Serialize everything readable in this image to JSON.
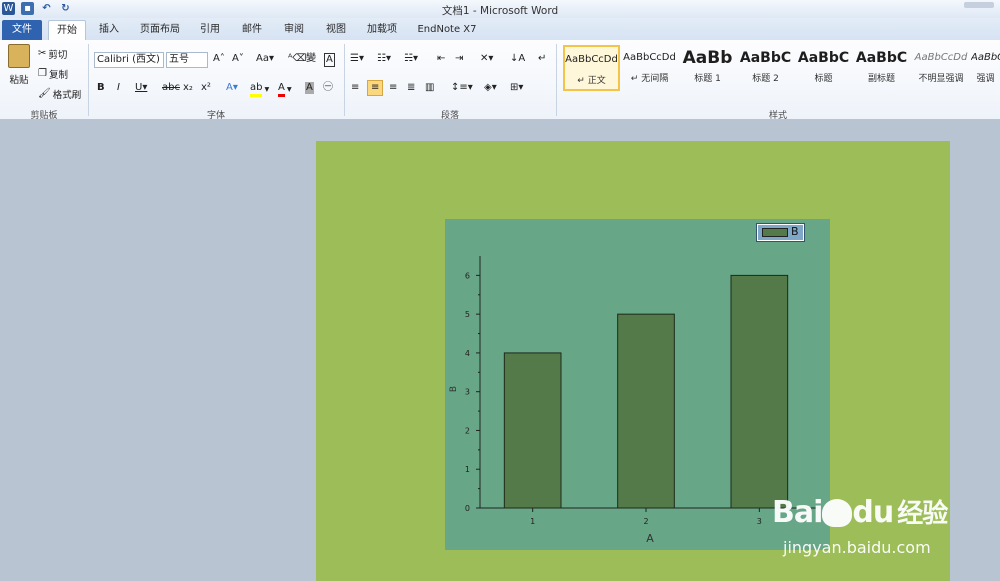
{
  "window": {
    "title": "文档1 - Microsoft Word"
  },
  "tabs": [
    "文件",
    "开始",
    "插入",
    "页面布局",
    "引用",
    "邮件",
    "审阅",
    "视图",
    "加载项",
    "EndNote X7"
  ],
  "clipboard": {
    "paste": "粘贴",
    "cut": "剪切",
    "copy": "复制",
    "format_painter": "格式刷",
    "group": "剪贴板"
  },
  "font": {
    "name": "Calibri (西文)",
    "size": "五号",
    "group": "字体"
  },
  "paragraph": {
    "group": "段落"
  },
  "styles": {
    "group": "样式",
    "items": [
      {
        "sample": "AaBbCcDd",
        "name": "↵ 正文"
      },
      {
        "sample": "AaBbCcDd",
        "name": "↵ 无间隔"
      },
      {
        "sample": "AaBb",
        "name": "标题 1"
      },
      {
        "sample": "AaBbC",
        "name": "标题 2"
      },
      {
        "sample": "AaBbC",
        "name": "标题"
      },
      {
        "sample": "AaBbC",
        "name": "副标题"
      },
      {
        "sample": "AaBbCcDd",
        "name": "不明显强调"
      },
      {
        "sample": "AaBbCcDd",
        "name": "强调"
      }
    ]
  },
  "chart_data": {
    "type": "bar",
    "categories": [
      "1",
      "2",
      "3"
    ],
    "series": [
      {
        "name": "B",
        "values": [
          4,
          5,
          6
        ]
      }
    ],
    "xlabel": "A",
    "ylabel": "B",
    "ylim": [
      0,
      6.5
    ],
    "yticks": [
      0,
      1,
      2,
      3,
      4,
      5,
      6
    ],
    "legend": "top-right",
    "grid": false,
    "colors": {
      "bar": "#547a49",
      "plot_bg": "#67a687",
      "page_bg": "#9cbd58"
    }
  },
  "watermark": {
    "brand": "Bai",
    "du": "du",
    "cn": "经验",
    "url": "jingyan.baidu.com"
  }
}
